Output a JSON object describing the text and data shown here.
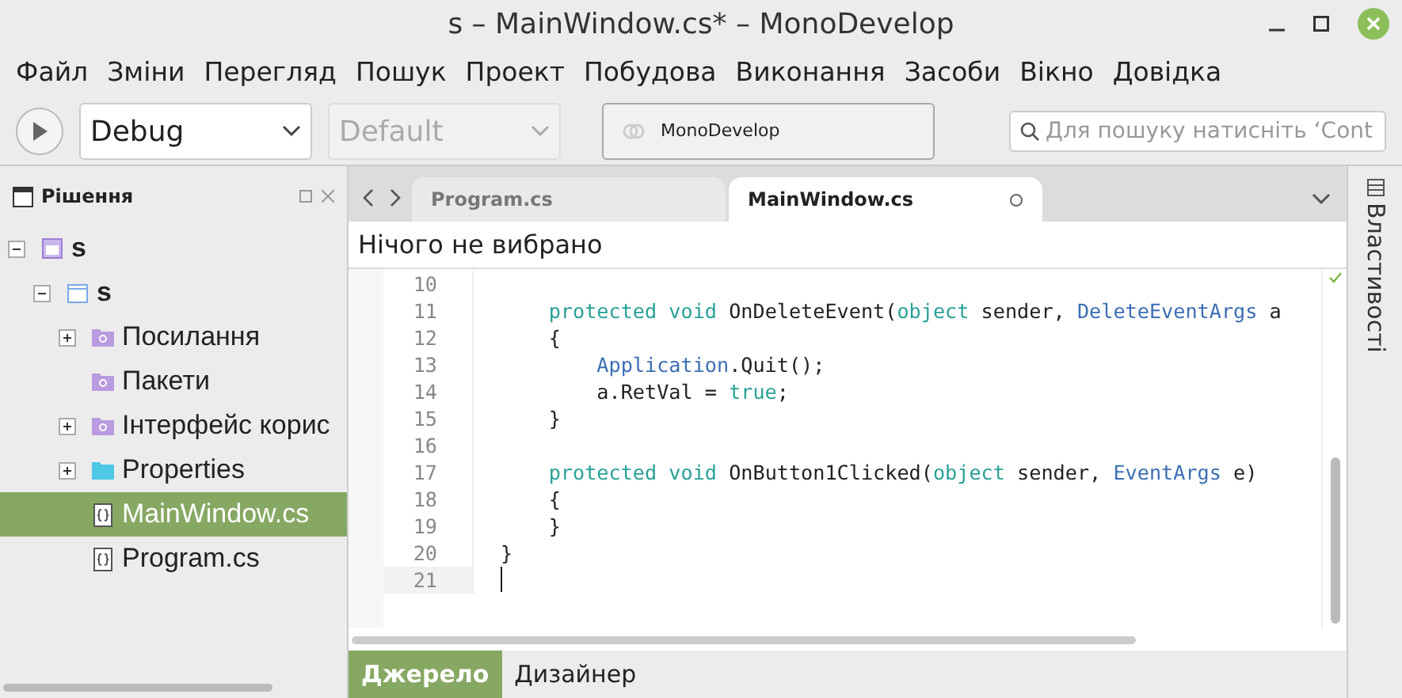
{
  "window": {
    "title": "s – MainWindow.cs* – MonoDevelop"
  },
  "menu": [
    "Файл",
    "Зміни",
    "Перегляд",
    "Пошук",
    "Проект",
    "Побудова",
    "Виконання",
    "Засоби",
    "Вікно",
    "Довідка"
  ],
  "toolbar": {
    "configuration": "Debug",
    "platform": {
      "value": "Default",
      "disabled": true
    },
    "status": "MonoDevelop",
    "search": {
      "placeholder": "Для пошуку натисніть ‘Cont"
    }
  },
  "solution_pad": {
    "title": "Рішення",
    "tree": [
      {
        "label": "s",
        "kind": "solution",
        "expanded": true,
        "selected": false,
        "children": [
          {
            "label": "s",
            "kind": "project",
            "expanded": true,
            "selected": false,
            "children": [
              {
                "label": "Посилання",
                "kind": "references",
                "expanded": false,
                "selected": false
              },
              {
                "label": "Пакети",
                "kind": "packages",
                "selected": false
              },
              {
                "label": "Інтерфейс корис",
                "kind": "ui",
                "expanded": false,
                "selected": false
              },
              {
                "label": "Properties",
                "kind": "folder",
                "expanded": false,
                "selected": false
              },
              {
                "label": "MainWindow.cs",
                "kind": "file",
                "selected": true
              },
              {
                "label": "Program.cs",
                "kind": "file",
                "selected": false
              }
            ]
          }
        ]
      }
    ]
  },
  "editor": {
    "tabs": [
      {
        "label": "Program.cs",
        "selected": false,
        "modified": false
      },
      {
        "label": "MainWindow.cs",
        "selected": true,
        "modified": true
      }
    ],
    "breadcrumb": "Нічого не вибрано",
    "lines": [
      {
        "number": "10",
        "current": false
      },
      {
        "number": "11",
        "current": false,
        "tokens": [
          {
            "kind": "keyword",
            "text": "    protected void"
          },
          {
            "kind": "plain",
            "text": " OnDeleteEvent("
          },
          {
            "kind": "keyword",
            "text": "object"
          },
          {
            "kind": "plain",
            "text": " sender, "
          },
          {
            "kind": "type",
            "text": "DeleteEventArgs"
          },
          {
            "kind": "plain",
            "text": " a"
          }
        ]
      },
      {
        "number": "12",
        "current": false,
        "tokens": [
          {
            "kind": "plain",
            "text": "    {"
          }
        ]
      },
      {
        "number": "13",
        "current": false,
        "tokens": [
          {
            "kind": "type",
            "text": "        Application"
          },
          {
            "kind": "plain",
            "text": ".Quit();"
          }
        ]
      },
      {
        "number": "14",
        "current": false,
        "tokens": [
          {
            "kind": "plain",
            "text": "        a.RetVal = "
          },
          {
            "kind": "keyword",
            "text": "true"
          },
          {
            "kind": "plain",
            "text": ";"
          }
        ]
      },
      {
        "number": "15",
        "current": false,
        "tokens": [
          {
            "kind": "plain",
            "text": "    }"
          }
        ]
      },
      {
        "number": "16",
        "current": false
      },
      {
        "number": "17",
        "current": false,
        "tokens": [
          {
            "kind": "keyword",
            "text": "    protected void"
          },
          {
            "kind": "plain",
            "text": " OnButton1Clicked("
          },
          {
            "kind": "keyword",
            "text": "object"
          },
          {
            "kind": "plain",
            "text": " sender, "
          },
          {
            "kind": "type",
            "text": "EventArgs"
          },
          {
            "kind": "plain",
            "text": " e)"
          }
        ]
      },
      {
        "number": "18",
        "current": false,
        "tokens": [
          {
            "kind": "plain",
            "text": "    {"
          }
        ]
      },
      {
        "number": "19",
        "current": false,
        "tokens": [
          {
            "kind": "plain",
            "text": "    }"
          }
        ]
      },
      {
        "number": "20",
        "current": false,
        "tokens": [
          {
            "kind": "plain",
            "text": "}"
          }
        ]
      },
      {
        "number": "21",
        "current": true
      }
    ],
    "view_tabs": [
      {
        "label": "Джерело",
        "selected": true
      },
      {
        "label": "Дизайнер",
        "selected": false
      }
    ]
  },
  "properties_pad": {
    "title": "Властивості"
  }
}
